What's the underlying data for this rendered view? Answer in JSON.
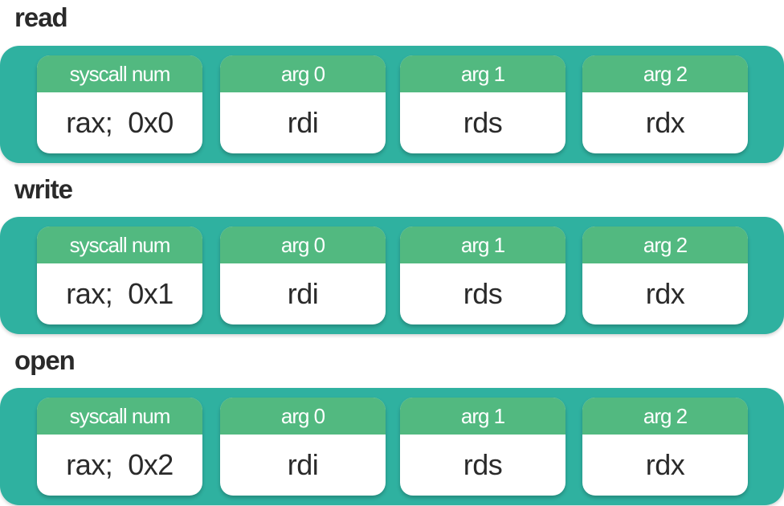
{
  "sections": [
    {
      "title": "read",
      "cells": [
        {
          "header": "syscall num",
          "value": "rax;  0x0"
        },
        {
          "header": "arg 0",
          "value": "rdi"
        },
        {
          "header": "arg 1",
          "value": "rds"
        },
        {
          "header": "arg 2",
          "value": "rdx"
        }
      ]
    },
    {
      "title": "write",
      "cells": [
        {
          "header": "syscall num",
          "value": "rax;  0x1"
        },
        {
          "header": "arg 0",
          "value": "rdi"
        },
        {
          "header": "arg 1",
          "value": "rds"
        },
        {
          "header": "arg 2",
          "value": "rdx"
        }
      ]
    },
    {
      "title": "open",
      "cells": [
        {
          "header": "syscall num",
          "value": "rax;  0x2"
        },
        {
          "header": "arg 0",
          "value": "rdi"
        },
        {
          "header": "arg 1",
          "value": "rds"
        },
        {
          "header": "arg 2",
          "value": "rdx"
        }
      ]
    }
  ],
  "colors": {
    "band": "#2fb1a0",
    "header": "#52b980",
    "cell_bg": "#ffffff",
    "title_text": "#2a2a2a"
  }
}
